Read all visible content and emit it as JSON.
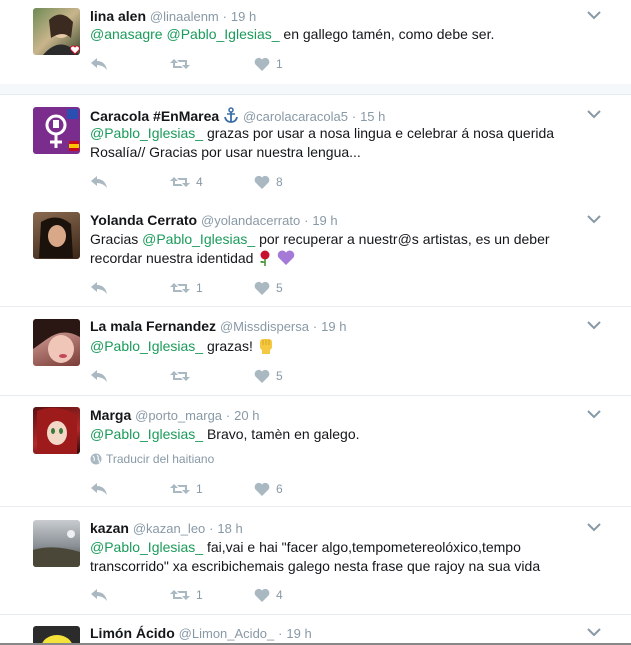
{
  "tweets": [
    {
      "name": "lina alen",
      "handle": "@linaalenm",
      "time": "19 h",
      "parts": [
        {
          "t": "@anasagre @Pablo_Iglesias_",
          "m": true
        },
        {
          "t": " en gallego tamén, como debe ser.",
          "m": false
        }
      ],
      "replies": "",
      "retweets": "",
      "likes": "1"
    },
    {
      "name": "Caracola #EnMarea",
      "handle": "@carolacaracola5",
      "time": "15 h",
      "parts": [
        {
          "t": "@Pablo_Iglesias_",
          "m": true
        },
        {
          "t": " grazas por usar a nosa lingua e celebrar á nosa querida Rosalía// Gracias por usar nuestra lengua...",
          "m": false
        }
      ],
      "replies": "",
      "retweets": "4",
      "likes": "8"
    },
    {
      "name": "Yolanda Cerrato",
      "handle": "@yolandacerrato",
      "time": "19 h",
      "parts": [
        {
          "t": "Gracias ",
          "m": false
        },
        {
          "t": "@Pablo_Iglesias_",
          "m": true
        },
        {
          "t": "  por recuperar a nuestr@s artistas, es un deber recordar nuestra identidad ",
          "m": false
        }
      ],
      "replies": "",
      "retweets": "1",
      "likes": "5"
    },
    {
      "name": "La mala Fernandez",
      "handle": "@Missdispersa",
      "time": "19 h",
      "parts": [
        {
          "t": "@Pablo_Iglesias_",
          "m": true
        },
        {
          "t": " grazas! ",
          "m": false
        }
      ],
      "replies": "",
      "retweets": "",
      "likes": "5"
    },
    {
      "name": "Marga",
      "handle": "@porto_marga",
      "time": "20 h",
      "parts": [
        {
          "t": "@Pablo_Iglesias_",
          "m": true
        },
        {
          "t": " Bravo, tamèn en galego.",
          "m": false
        }
      ],
      "translate": "Traducir del haitiano",
      "replies": "",
      "retweets": "1",
      "likes": "6"
    },
    {
      "name": "kazan",
      "handle": "@kazan_leo",
      "time": "18 h",
      "parts": [
        {
          "t": "@Pablo_Iglesias_",
          "m": true
        },
        {
          "t": " fai,vai e hai \"facer algo,tempometereolóxico,tempo transcorrido\" xa escribichemais galego nesta frase que rajoy na sua vida",
          "m": false
        }
      ],
      "replies": "",
      "retweets": "1",
      "likes": "4"
    },
    {
      "name": "Limón Ácido",
      "handle": "@Limon_Acido_",
      "time": "19 h",
      "parts": [],
      "replies": "",
      "retweets": "",
      "likes": ""
    }
  ],
  "separator": "·",
  "icons": {
    "reply": "reply-icon",
    "retweet": "retweet-icon",
    "like": "heart-icon",
    "more": "chevron-down-icon",
    "globe": "globe-icon",
    "anchor": "anchor-emoji"
  },
  "colors": {
    "mention": "#1a9b5a",
    "muted": "#8899a6",
    "border": "#e6ecf0"
  }
}
